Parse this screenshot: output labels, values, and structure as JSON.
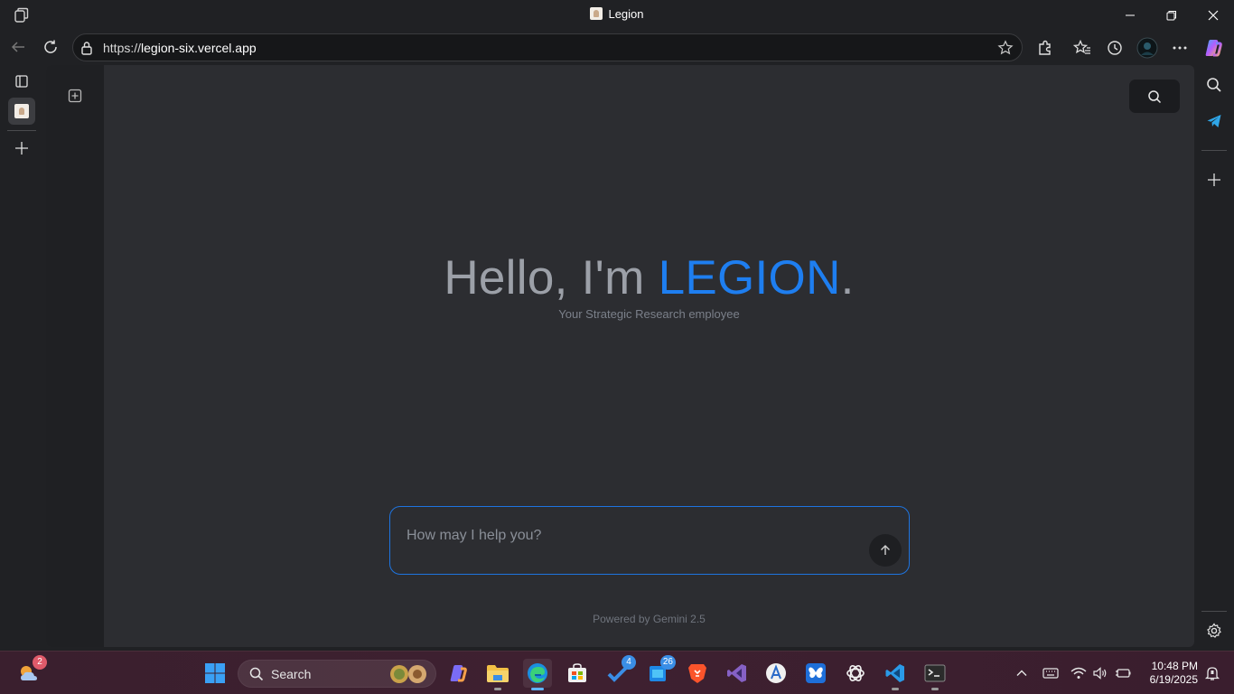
{
  "window": {
    "title": "Legion"
  },
  "browser": {
    "url_prefix": "https://",
    "url_host": "legion-six.vercel.app"
  },
  "app": {
    "greeting_prefix": "Hello, I'm ",
    "brand": "LEGION",
    "greeting_suffix": ".",
    "subtitle": "Your Strategic Research employee",
    "input_placeholder": "How may I help you?",
    "input_value": "",
    "footer": "Powered by Gemini 2.5",
    "accent_color": "#1e7ef0"
  },
  "taskbar": {
    "weather_badge": "2",
    "search_label": "Search",
    "todo_badge": "4",
    "app_badge": "26",
    "time": "10:48 PM",
    "date": "6/19/2025"
  },
  "icons": {
    "titlebar": [
      "workspaces-icon",
      "minimize-icon",
      "restore-icon",
      "close-icon"
    ],
    "nav": [
      "back-icon",
      "refresh-icon",
      "lock-icon",
      "favorite-star-icon",
      "extensions-icon",
      "favorites-icon",
      "history-icon",
      "profile-avatar",
      "more-icon",
      "copilot-icon"
    ],
    "right_sidebar": [
      "search-icon",
      "telegram-icon",
      "add-icon",
      "settings-icon"
    ]
  }
}
